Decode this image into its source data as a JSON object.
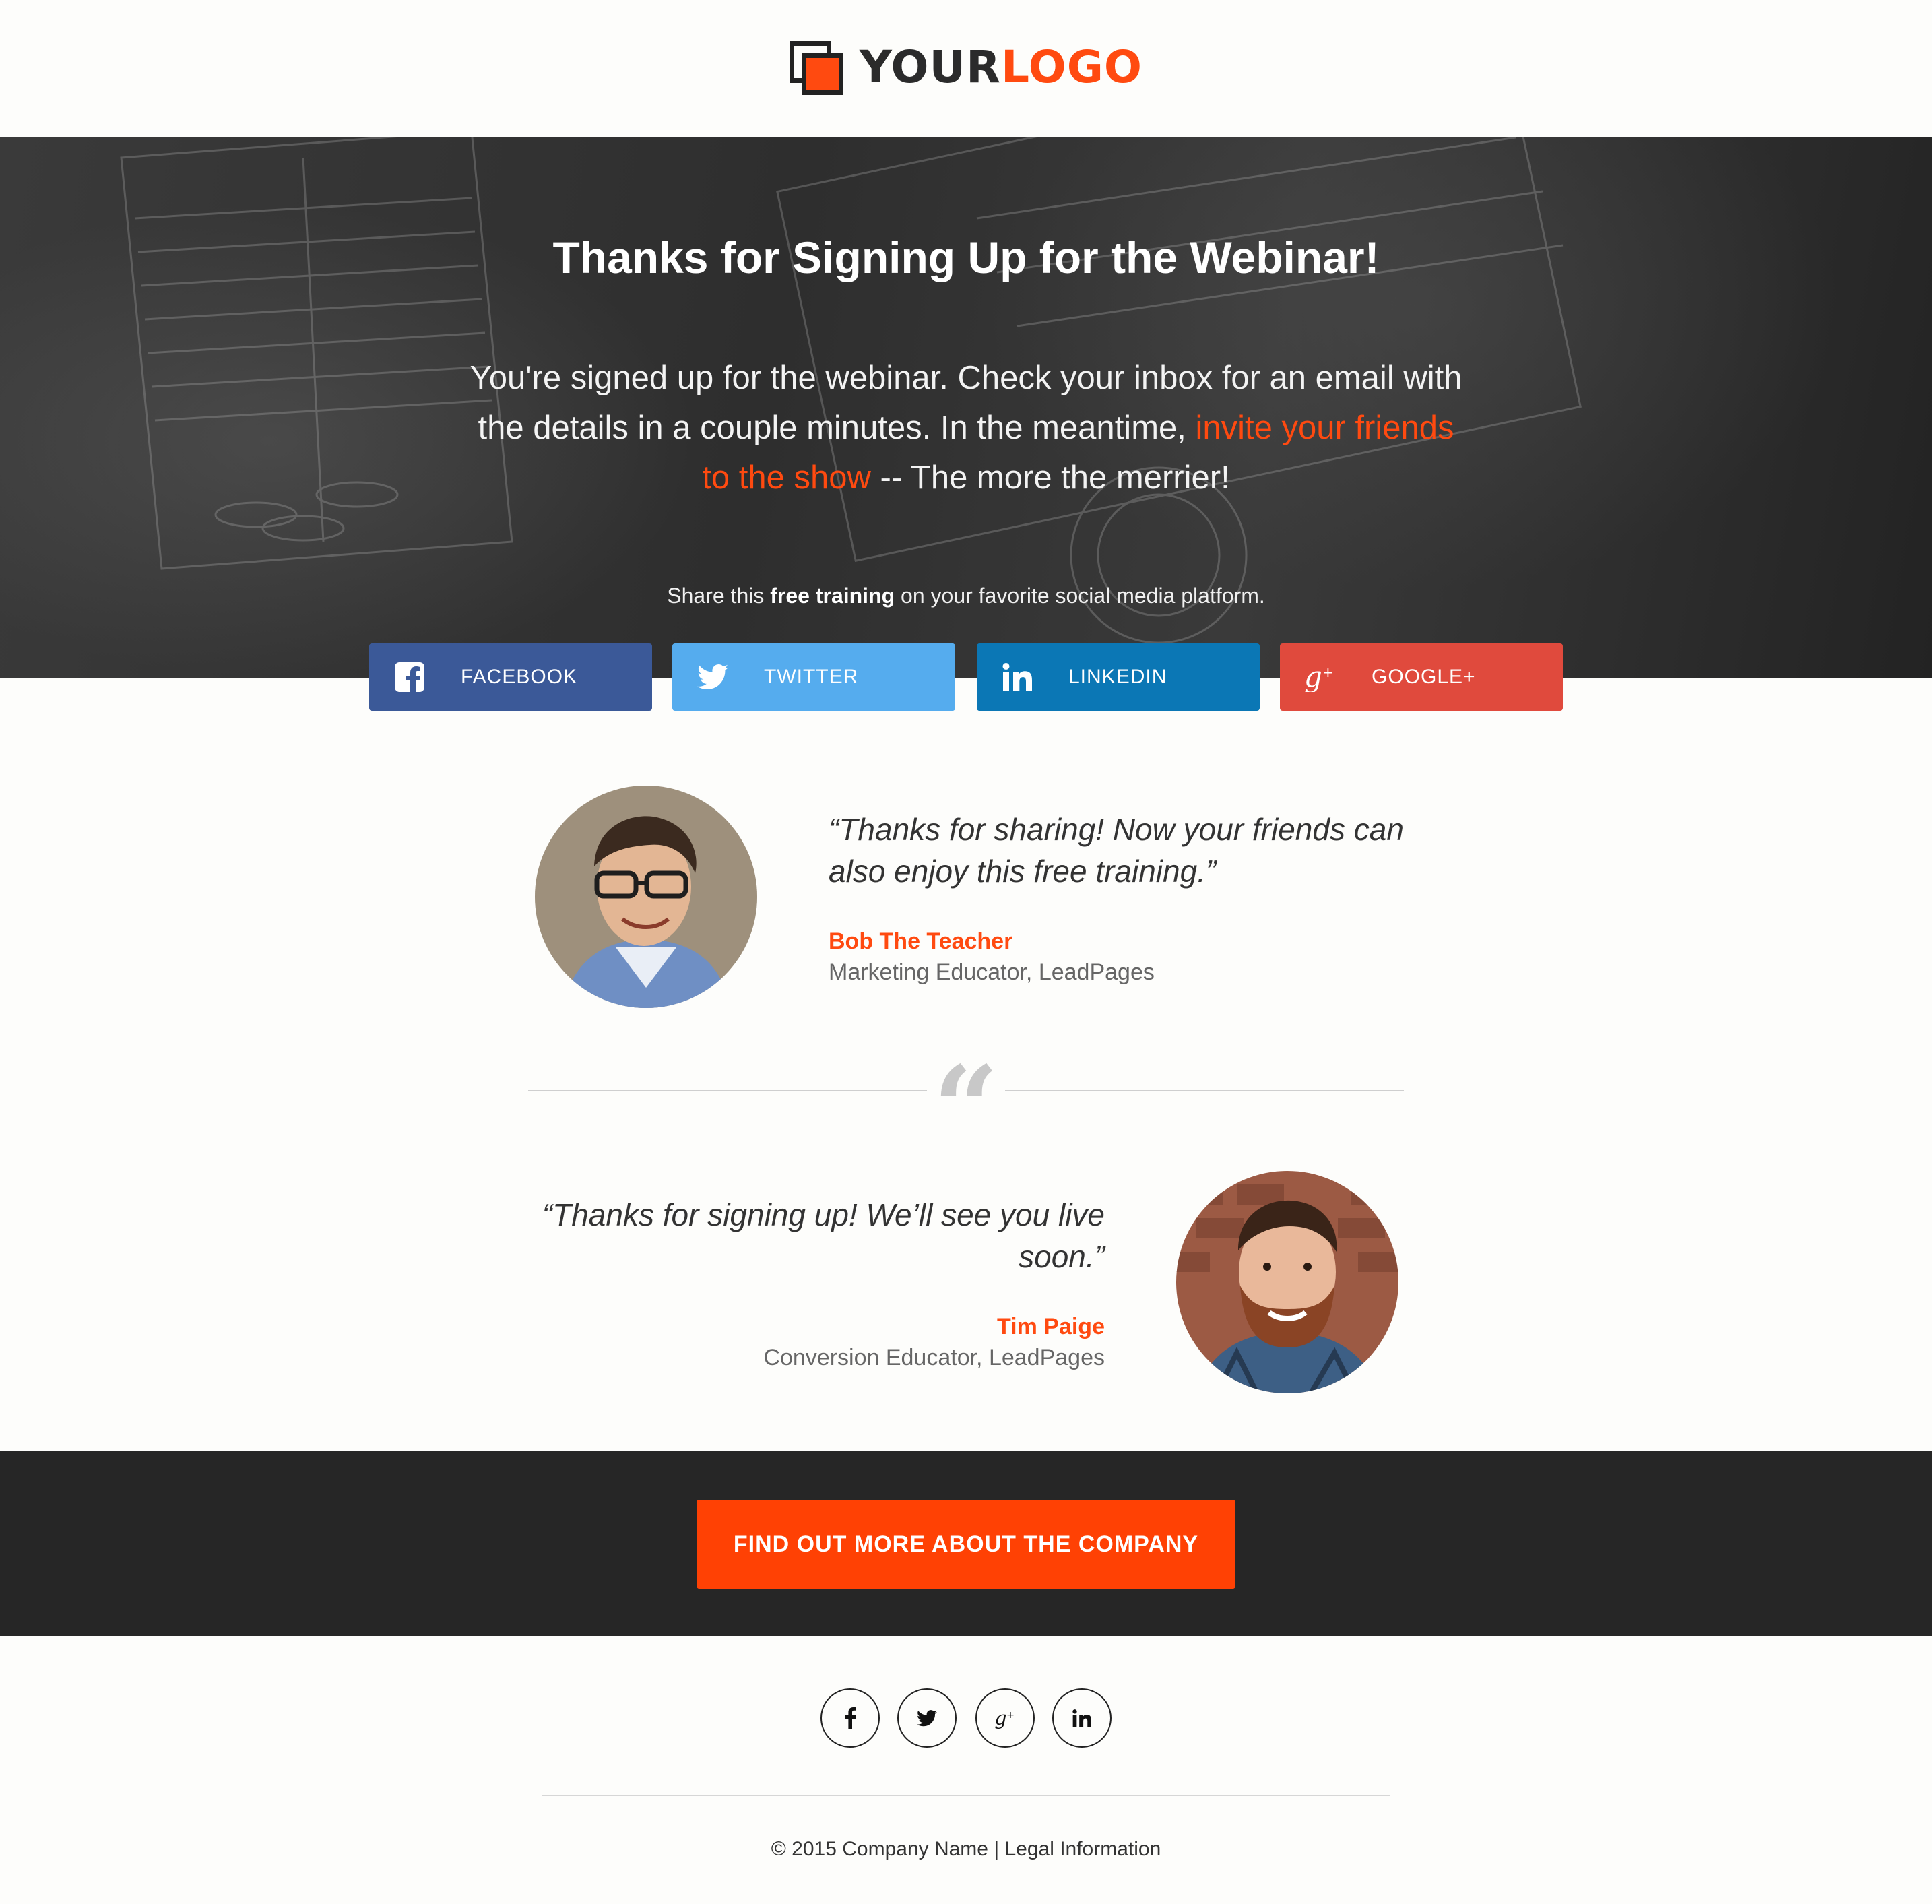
{
  "logo": {
    "part1": "YOUR",
    "part2": "LOGO",
    "accent": "#ff4a10"
  },
  "hero": {
    "title": "Thanks for Signing Up for the Webinar!",
    "body_before": "You're signed up for the webinar. Check your inbox for an email with the details in a couple minutes. In the meantime, ",
    "body_link": "invite your friends to the show",
    "body_after": " -- The more the merrier!",
    "share_before": "Share this ",
    "share_bold": "free training",
    "share_after": " on your favorite social media platform."
  },
  "share_buttons": [
    {
      "label": "FACEBOOK",
      "icon": "facebook-icon",
      "color": "#3b5998"
    },
    {
      "label": "TWITTER",
      "icon": "twitter-icon",
      "color": "#55acee"
    },
    {
      "label": "LINKEDIN",
      "icon": "linkedin-icon",
      "color": "#0b77b5"
    },
    {
      "label": "GOOGLE+",
      "icon": "google-plus-icon",
      "color": "#e04a3d"
    }
  ],
  "testimonials": [
    {
      "quote": "“Thanks for sharing! Now your friends can also enjoy this free training.”",
      "name": "Bob The Teacher",
      "role": "Marketing Educator, LeadPages"
    },
    {
      "quote": "“Thanks for signing up! We’ll see you live soon.”",
      "name": "Tim Paige",
      "role": "Conversion Educator, LeadPages"
    }
  ],
  "divider_glyph": "“",
  "cta": {
    "label": "FIND OUT MORE ABOUT THE COMPANY",
    "color": "#ff4104"
  },
  "footer": {
    "icons": [
      "facebook-icon",
      "twitter-icon",
      "google-plus-icon",
      "linkedin-icon"
    ],
    "copyright": "© 2015 Company Name",
    "separator": " | ",
    "legal": "Legal Information"
  }
}
